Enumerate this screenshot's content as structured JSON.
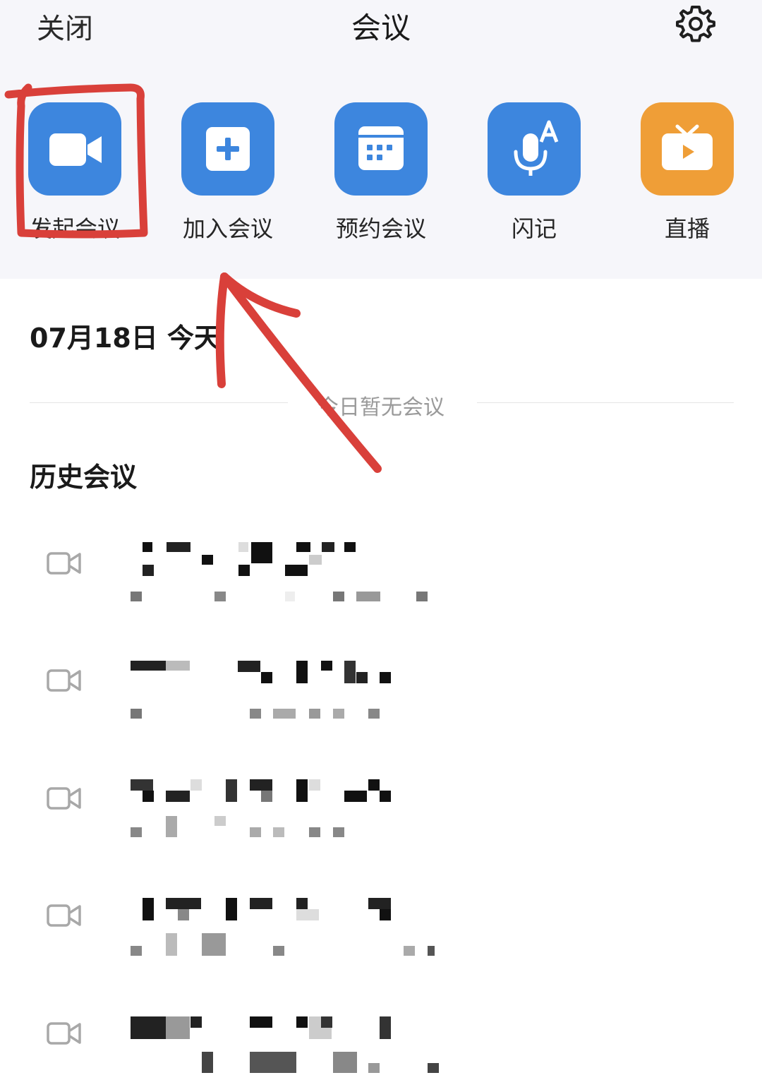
{
  "nav": {
    "close_label": "关闭",
    "title": "会议",
    "settings_icon": "gear-icon"
  },
  "actions": [
    {
      "label": "发起会议",
      "icon": "video-camera-icon",
      "color": "#3d86de"
    },
    {
      "label": "加入会议",
      "icon": "plus-square-icon",
      "color": "#3d86de"
    },
    {
      "label": "预约会议",
      "icon": "calendar-icon",
      "color": "#3d86de"
    },
    {
      "label": "闪记",
      "icon": "microphone-icon",
      "color": "#3d86de"
    },
    {
      "label": "直播",
      "icon": "tv-play-icon",
      "color": "#ef9e37"
    }
  ],
  "today": {
    "header": "07月18日 今天",
    "empty_text": "今日暂无会议"
  },
  "history": {
    "header": "历史会议",
    "items": [
      {
        "icon": "video-camera-outline-icon",
        "title": "",
        "subtitle": ""
      },
      {
        "icon": "video-camera-outline-icon",
        "title": "",
        "subtitle": ""
      },
      {
        "icon": "video-camera-outline-icon",
        "title": "",
        "subtitle": ""
      },
      {
        "icon": "video-camera-outline-icon",
        "title": "",
        "subtitle": ""
      },
      {
        "icon": "video-camera-outline-icon",
        "title": "",
        "subtitle": ""
      }
    ]
  },
  "annotation_color": "#d9403a"
}
